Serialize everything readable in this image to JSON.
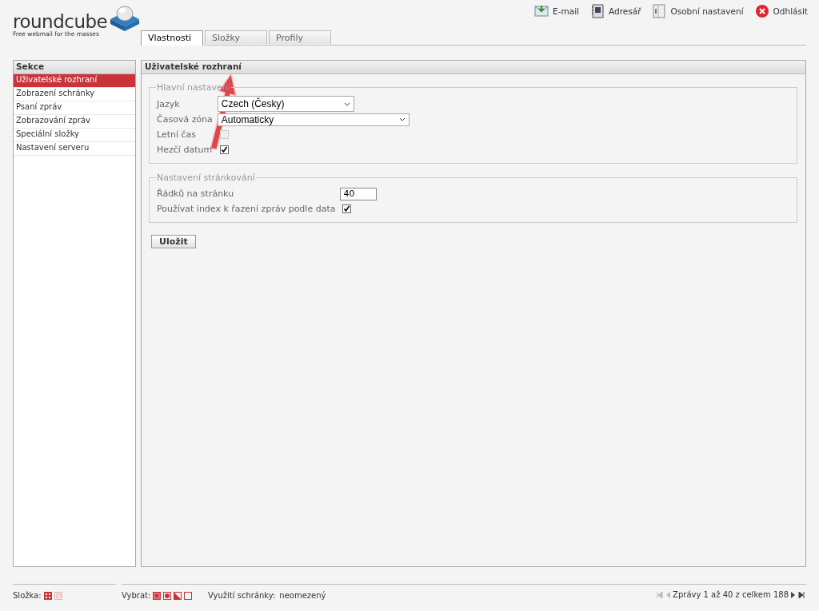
{
  "logo": {
    "name": "roundcube",
    "tagline": "Free webmail for the masses"
  },
  "top_nav": [
    {
      "label": "E-mail",
      "kind": "mail"
    },
    {
      "label": "Adresář",
      "kind": "contacts"
    },
    {
      "label": "Osobní nastavení",
      "kind": "settings"
    },
    {
      "label": "Odhlásit",
      "kind": "logout"
    }
  ],
  "tabs": [
    {
      "label": "Vlastnosti",
      "selected": true
    },
    {
      "label": "Složky",
      "selected": false
    },
    {
      "label": "Profily",
      "selected": false
    }
  ],
  "sidebar": {
    "title": "Sekce",
    "items": [
      {
        "label": "Uživatelské rozhraní",
        "selected": true
      },
      {
        "label": "Zobrazení schránky",
        "selected": false
      },
      {
        "label": "Psaní zpráv",
        "selected": false
      },
      {
        "label": "Zobrazování zpráv",
        "selected": false
      },
      {
        "label": "Speciální složky",
        "selected": false
      },
      {
        "label": "Nastavení serveru",
        "selected": false
      }
    ]
  },
  "panel": {
    "title": "Uživatelské rozhraní",
    "fieldsets": [
      {
        "legend": "Hlavní nastavení",
        "rows": [
          {
            "kind": "select",
            "label": "Jazyk",
            "value": "Czech (Česky)"
          },
          {
            "kind": "select",
            "label": "Časová zóna",
            "value": "Automaticky"
          },
          {
            "kind": "checkbox",
            "label": "Letní čas",
            "checked": false,
            "disabled": true
          },
          {
            "kind": "checkbox",
            "label": "Hezčí datum",
            "checked": true,
            "disabled": false
          }
        ]
      },
      {
        "legend": "Nastavení stránkování",
        "rows": [
          {
            "kind": "text",
            "label": "Řádků na stránku",
            "value": "40"
          },
          {
            "kind": "checkbox",
            "label": "Používat index k řazení zpráv podle data",
            "checked": true,
            "disabled": false
          }
        ]
      }
    ],
    "save_button": "Uložit"
  },
  "footer": {
    "folder_label": "Složka:",
    "select_label": "Vybrat:",
    "quota_label": "Využití schránky:",
    "quota_value": "neomezený",
    "message_count": "Zprávy 1 až 40 z celkem 188"
  }
}
